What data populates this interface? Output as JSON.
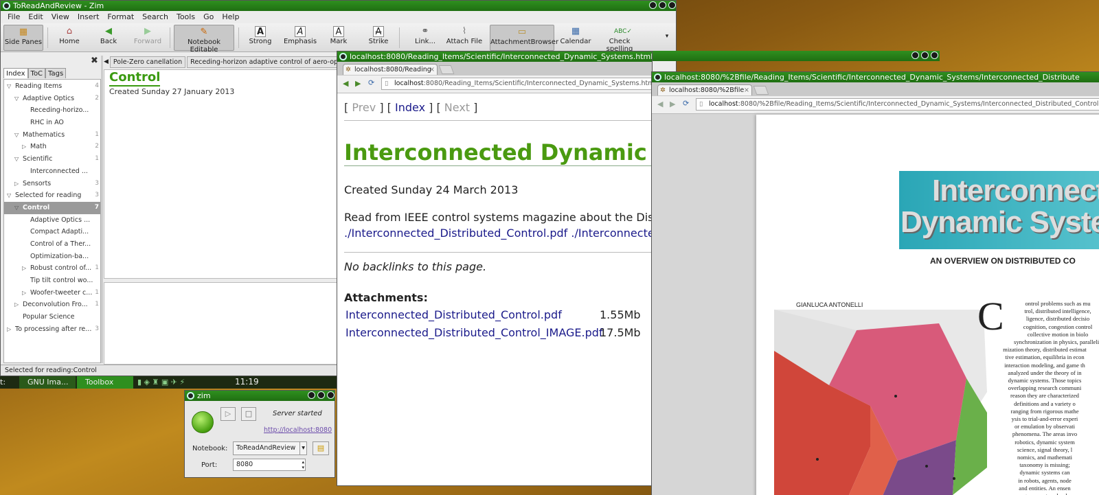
{
  "zim": {
    "title": "ToReadAndReview - Zim",
    "menu": [
      "File",
      "Edit",
      "View",
      "Insert",
      "Format",
      "Search",
      "Tools",
      "Go",
      "Help"
    ],
    "toolbar": {
      "side_panes": "Side Panes",
      "home": "Home",
      "back": "Back",
      "forward": "Forward",
      "notebook_editable": "Notebook Editable",
      "strong": "Strong",
      "emphasis": "Emphasis",
      "mark": "Mark",
      "strike": "Strike",
      "link": "Link...",
      "attach_file": "Attach File",
      "attachment_browser": "AttachmentBrowser",
      "calendar": "Calendar",
      "check_spelling": "Check spelling"
    },
    "tabs": [
      "Index",
      "ToC",
      "Tags"
    ],
    "tree": [
      {
        "label": "Reading Items",
        "count": "4",
        "level": 0,
        "arrow": "open"
      },
      {
        "label": "Adaptive Optics",
        "count": "2",
        "level": 1,
        "arrow": "open"
      },
      {
        "label": "Receding-horizo...",
        "count": "",
        "level": 2,
        "arrow": ""
      },
      {
        "label": "RHC in AO",
        "count": "",
        "level": 2,
        "arrow": ""
      },
      {
        "label": "Mathematics",
        "count": "1",
        "level": 1,
        "arrow": "open"
      },
      {
        "label": "Math",
        "count": "2",
        "level": 2,
        "arrow": "closed"
      },
      {
        "label": "Scientific",
        "count": "1",
        "level": 1,
        "arrow": "open"
      },
      {
        "label": "Interconnected ...",
        "count": "",
        "level": 2,
        "arrow": ""
      },
      {
        "label": "Sensorts",
        "count": "3",
        "level": 1,
        "arrow": "closed"
      },
      {
        "label": "Selected for reading",
        "count": "3",
        "level": 0,
        "arrow": "open"
      },
      {
        "label": "Control",
        "count": "7",
        "level": 1,
        "arrow": "open",
        "selected": true
      },
      {
        "label": "Adaptive Optics ...",
        "count": "",
        "level": 2,
        "arrow": ""
      },
      {
        "label": "Compact Adapti...",
        "count": "",
        "level": 2,
        "arrow": ""
      },
      {
        "label": "Control of a Ther...",
        "count": "",
        "level": 2,
        "arrow": ""
      },
      {
        "label": "Optimization-ba...",
        "count": "",
        "level": 2,
        "arrow": ""
      },
      {
        "label": "Robust control of...",
        "count": "1",
        "level": 2,
        "arrow": "closed"
      },
      {
        "label": "Tip tilt control wo...",
        "count": "",
        "level": 2,
        "arrow": ""
      },
      {
        "label": "Woofer-tweeter c...",
        "count": "1",
        "level": 2,
        "arrow": "closed"
      },
      {
        "label": "Deconvolution Fro...",
        "count": "1",
        "level": 1,
        "arrow": "closed"
      },
      {
        "label": "Popular Science",
        "count": "",
        "level": 1,
        "arrow": ""
      },
      {
        "label": "To processing after re...",
        "count": "3",
        "level": 0,
        "arrow": "closed"
      }
    ],
    "pathbar": [
      "Pole-Zero canellation",
      "Receding-horizon adaptive control of aero-opti"
    ],
    "page_title": "Control",
    "page_created": "Created Sunday 27 January 2013",
    "status": "Selected for reading:Control"
  },
  "panel": {
    "item1": "t:",
    "item2": "GNU Ima...",
    "item3": "Toolbox",
    "clock": "11:19"
  },
  "server": {
    "title": "zim",
    "status": "Server started",
    "url": "http://localhost:8080",
    "notebook_label": "Notebook:",
    "notebook_value": "ToReadAndReview",
    "port_label": "Port:",
    "port_value": "8080"
  },
  "chrome1": {
    "title": "localhost:8080/Reading_Items/Scientific/Interconnected_Dynamic_Systems.html - Google Chrome",
    "tab": "localhost:8080/Reading",
    "url_host": "localhost",
    "url_rest": ":8080/Reading_Items/Scientific/Interconnected_Dynamic_Systems.html",
    "nav_prev": "Prev",
    "nav_index": "Index",
    "nav_next": "Next",
    "heading": "Interconnected Dynamic S",
    "created": "Created Sunday 24 March 2013",
    "body": "Read from IEEE control systems magazine about the Distrib",
    "links_line": "./Interconnected_Distributed_Control.pdf ./Interconnected_",
    "backlinks": "No backlinks to this page.",
    "attachments_heading": "Attachments:",
    "attachments": [
      {
        "name": "Interconnected_Distributed_Control.pdf",
        "size": "1.55Mb"
      },
      {
        "name": "Interconnected_Distributed_Control_IMAGE.pdf",
        "size": "17.5Mb"
      }
    ]
  },
  "chrome2": {
    "title": "localhost:8080/%2Bfile/Reading_Items/Scientific/Interconnected_Dynamic_Systems/Interconnected_Distribute",
    "tab": "localhost:8080/%2Bfile",
    "url_host": "localhost",
    "url_rest": ":8080/%2Bfile/Reading_Items/Scientific/Interconnected_Dynamic_Systems/Interconnected_Distributed_Control",
    "pdf_title_1": "Interconnect",
    "pdf_title_2": "Dynamic Syster",
    "pdf_subtitle": "AN OVERVIEW ON DISTRIBUTED CO",
    "pdf_author": "GIANLUCA ANTONELLI",
    "pdf_dropcap": "C",
    "pdf_text": [
      "ontrol problems such as mu",
      "trol, distributed intelligence,",
      "ligence, distributed decisio",
      "cognition, congestion control",
      "collective motion in biolo",
      "synchronization in physics, paralleliz",
      "mization theory, distributed estimat",
      "tive estimation, equilibria in econ",
      "interaction modeling, and game th",
      "analyzed under the theory of in",
      "dynamic systems. Those topics",
      "overlapping research communi",
      "reason they are characterized",
      "definitions and a variety o",
      "ranging from rigorous mathe",
      "ysis to trial-and-error experi",
      "or emulation by observati",
      "phenomena. The areas invo",
      "robotics, dynamic system",
      "science, signal theory, l",
      "nomics, and mathemati",
      "taxonomy is missing;",
      "dynamic systems can",
      "in robots, agents, node",
      "and entities. An ensen",
      "a group, network, pla"
    ]
  }
}
